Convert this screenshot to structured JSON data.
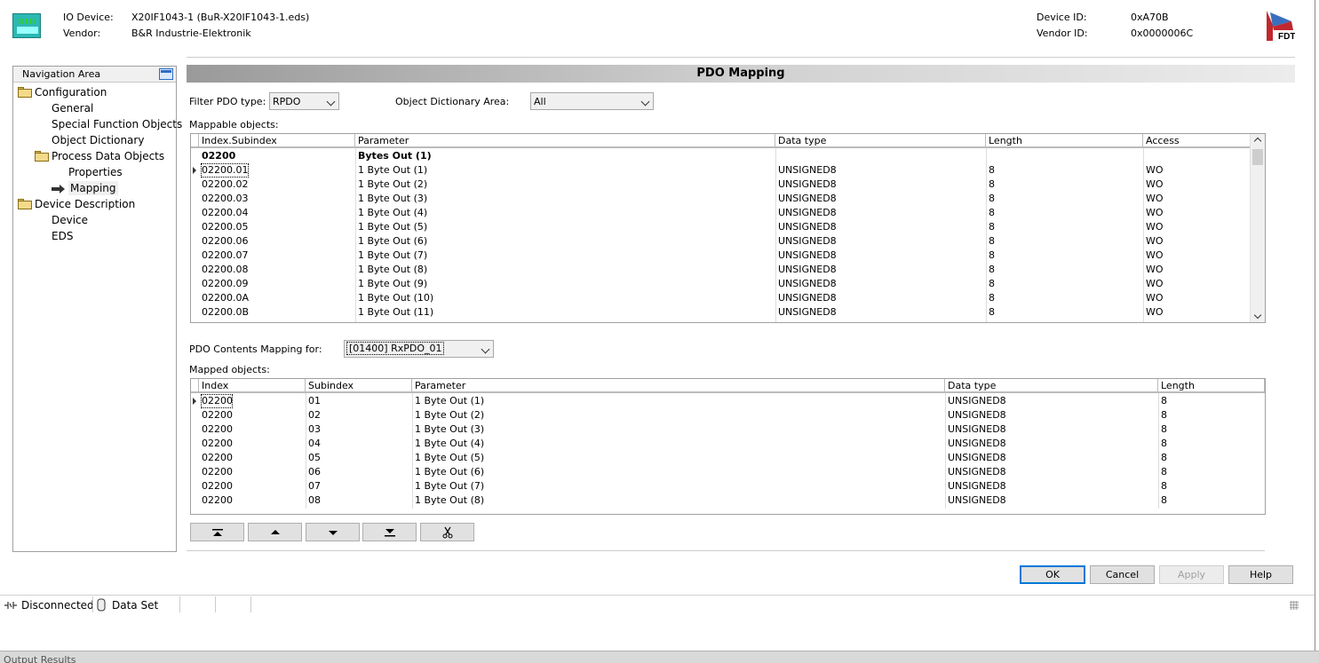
{
  "header": {
    "io_device_label": "IO Device:",
    "io_device_value": "X20IF1043-1 (BuR-X20IF1043-1.eds)",
    "vendor_label": "Vendor:",
    "vendor_value": "B&R Industrie-Elektronik",
    "device_id_label": "Device ID:",
    "device_id_value": "0xA70B",
    "vendor_id_label": "Vendor ID:",
    "vendor_id_value": "0x0000006C",
    "logo_text": "FDT"
  },
  "nav": {
    "title": "Navigation Area",
    "items": [
      {
        "label": "Configuration",
        "icon": "folder-icon"
      },
      {
        "label": "General"
      },
      {
        "label": "Special Function Objects"
      },
      {
        "label": "Object Dictionary"
      },
      {
        "label": "Process Data Objects",
        "icon": "folder-icon"
      },
      {
        "label": "Properties"
      },
      {
        "label": "Mapping",
        "icon": "arrow-right-icon"
      },
      {
        "label": "Device Description",
        "icon": "folder-icon"
      },
      {
        "label": "Device"
      },
      {
        "label": "EDS"
      }
    ]
  },
  "main": {
    "title": "PDO Mapping",
    "filter_label": "Filter PDO type:",
    "filter_value": "RPDO",
    "area_label": "Object Dictionary Area:",
    "area_value": "All",
    "mappable_label": "Mappable objects:",
    "mappable_columns": [
      "Index.Subindex",
      "Parameter",
      "Data type",
      "Length",
      "Access"
    ],
    "mappable_rows": [
      [
        "02200",
        "Bytes Out (1)",
        "",
        "",
        ""
      ],
      [
        "02200.01",
        "1 Byte Out (1)",
        "UNSIGNED8",
        "8",
        "WO"
      ],
      [
        "02200.02",
        "1 Byte Out (2)",
        "UNSIGNED8",
        "8",
        "WO"
      ],
      [
        "02200.03",
        "1 Byte Out (3)",
        "UNSIGNED8",
        "8",
        "WO"
      ],
      [
        "02200.04",
        "1 Byte Out (4)",
        "UNSIGNED8",
        "8",
        "WO"
      ],
      [
        "02200.05",
        "1 Byte Out (5)",
        "UNSIGNED8",
        "8",
        "WO"
      ],
      [
        "02200.06",
        "1 Byte Out (6)",
        "UNSIGNED8",
        "8",
        "WO"
      ],
      [
        "02200.07",
        "1 Byte Out (7)",
        "UNSIGNED8",
        "8",
        "WO"
      ],
      [
        "02200.08",
        "1 Byte Out (8)",
        "UNSIGNED8",
        "8",
        "WO"
      ],
      [
        "02200.09",
        "1 Byte Out (9)",
        "UNSIGNED8",
        "8",
        "WO"
      ],
      [
        "02200.0A",
        "1 Byte Out (10)",
        "UNSIGNED8",
        "8",
        "WO"
      ],
      [
        "02200.0B",
        "1 Byte Out (11)",
        "UNSIGNED8",
        "8",
        "WO"
      ]
    ],
    "contents_label": "PDO Contents Mapping for:",
    "contents_value": "[01400] RxPDO_01",
    "mapped_label": "Mapped objects:",
    "mapped_columns": [
      "Index",
      "Subindex",
      "Parameter",
      "Data type",
      "Length"
    ],
    "mapped_rows": [
      [
        "02200",
        "01",
        "1 Byte Out (1)",
        "UNSIGNED8",
        "8"
      ],
      [
        "02200",
        "02",
        "1 Byte Out (2)",
        "UNSIGNED8",
        "8"
      ],
      [
        "02200",
        "03",
        "1 Byte Out (3)",
        "UNSIGNED8",
        "8"
      ],
      [
        "02200",
        "04",
        "1 Byte Out (4)",
        "UNSIGNED8",
        "8"
      ],
      [
        "02200",
        "05",
        "1 Byte Out (5)",
        "UNSIGNED8",
        "8"
      ],
      [
        "02200",
        "06",
        "1 Byte Out (6)",
        "UNSIGNED8",
        "8"
      ],
      [
        "02200",
        "07",
        "1 Byte Out (7)",
        "UNSIGNED8",
        "8"
      ],
      [
        "02200",
        "08",
        "1 Byte Out (8)",
        "UNSIGNED8",
        "8"
      ]
    ],
    "toolbar_icons": [
      "move-top-icon",
      "move-up-icon",
      "move-down-icon",
      "move-bottom-icon",
      "cut-icon"
    ]
  },
  "buttons": {
    "ok": "OK",
    "cancel": "Cancel",
    "apply": "Apply",
    "help": "Help"
  },
  "status": {
    "connection": "Disconnected",
    "dataset": "Data Set"
  },
  "bottom": {
    "panel_title": "Output Results"
  }
}
